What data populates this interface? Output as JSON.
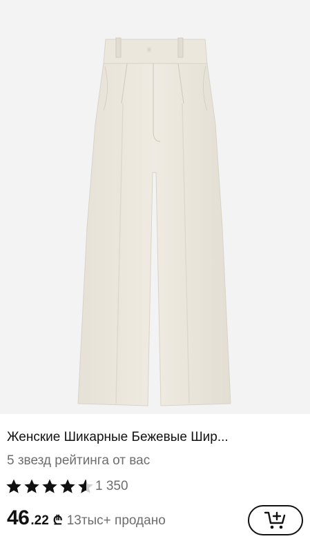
{
  "product": {
    "image_icon": "wide-leg-trousers-photo",
    "title": "Женские Шикарные Бежевые Шир...",
    "rating_note": "5 звезд рейтинга от вас",
    "rating": 4.5,
    "review_count": "1 350",
    "price_int": "46",
    "price_dec": ".22",
    "currency_symbol": "₾",
    "sold": "13тыс+ продано",
    "cart_icon": "add-to-cart-icon"
  }
}
